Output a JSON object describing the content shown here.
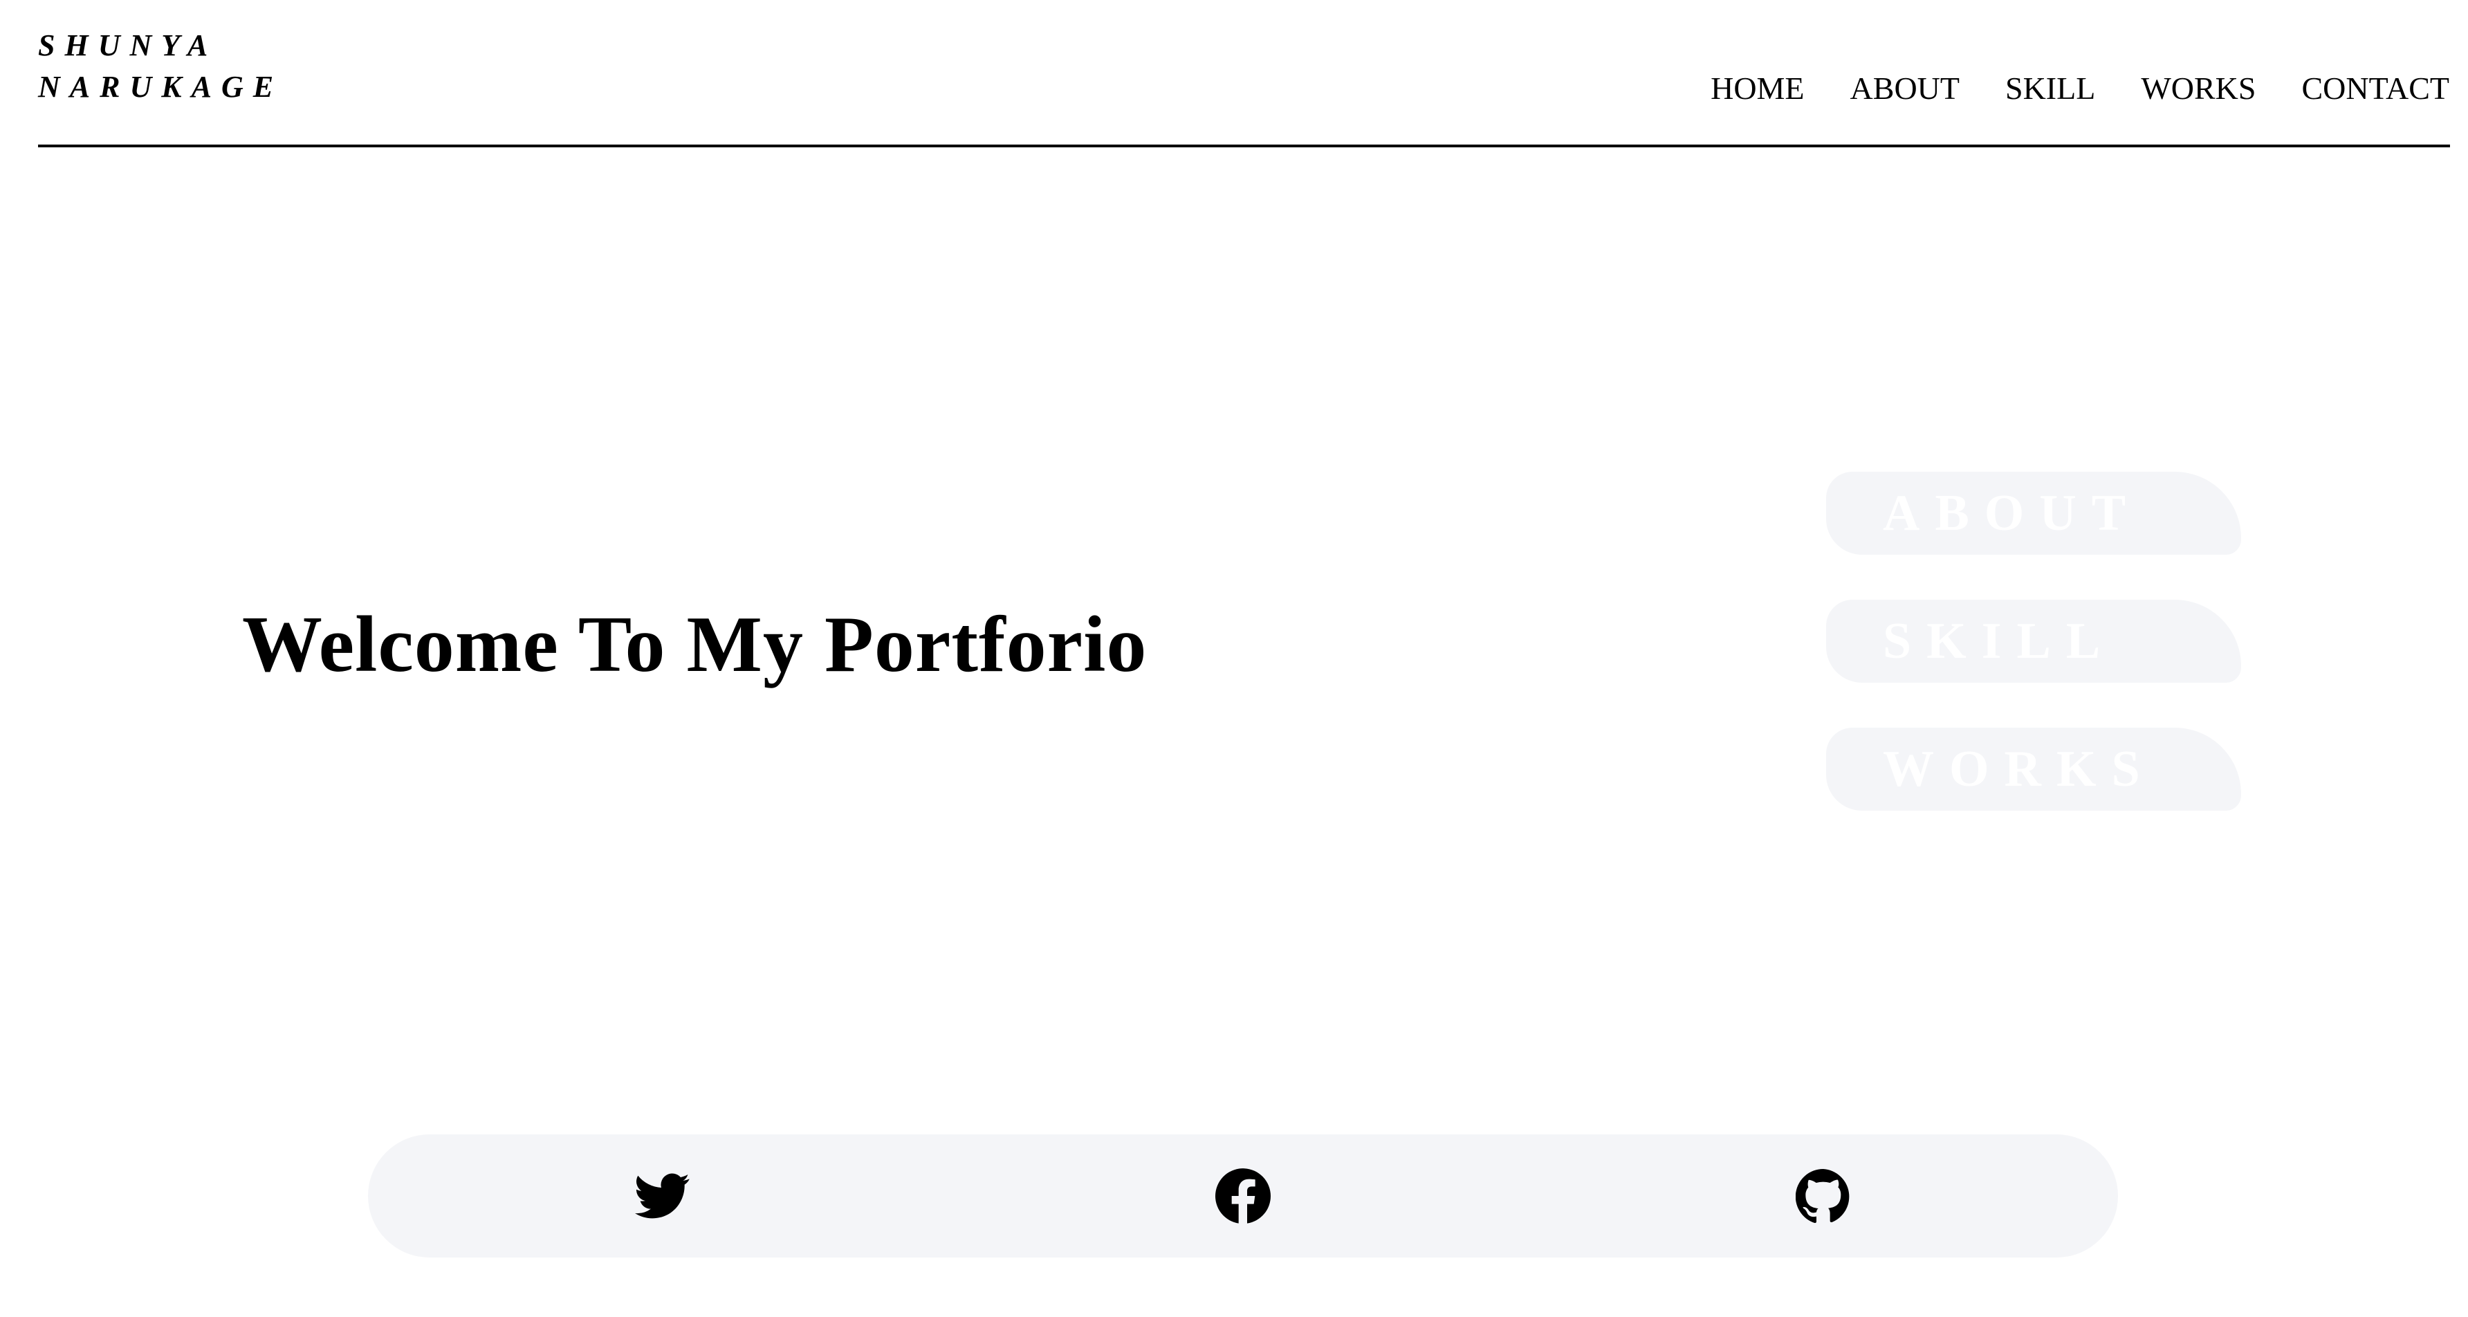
{
  "header": {
    "logo_line1": "SHUNYA",
    "logo_line2": "NARUKAGE",
    "nav": {
      "home": "HOME",
      "about": "ABOUT",
      "skill": "SKILL",
      "works": "WORKS",
      "contact": "CONTACT"
    }
  },
  "hero": {
    "title": "Welcome To My Portforio"
  },
  "side_links": {
    "about": "ABOUT",
    "skill": "SKILL",
    "works": "WORKS"
  },
  "social": {
    "icons": [
      "twitter-icon",
      "facebook-icon",
      "github-icon"
    ]
  },
  "colors": {
    "text": "#000000",
    "panel_background": "#f4f5f8",
    "side_link_text": "#ffffff"
  }
}
